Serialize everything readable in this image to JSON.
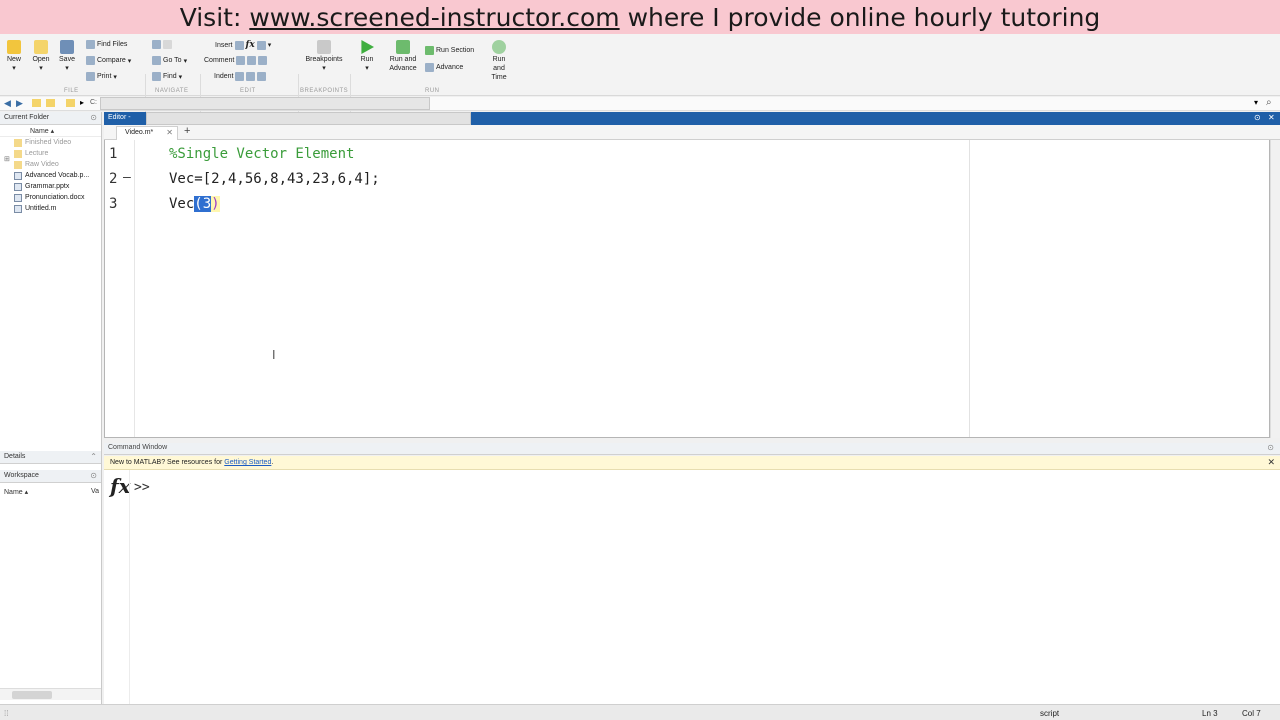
{
  "banner": {
    "prefix": "Visit:",
    "link": "www.screened-instructor.com",
    "suffix": "where I provide online hourly tutoring"
  },
  "toolbar": {
    "new": "New",
    "open": "Open",
    "save": "Save",
    "find_files": "Find Files",
    "compare": "Compare",
    "print": "Print",
    "go_to": "Go To",
    "find": "Find",
    "insert": "Insert",
    "comment": "Comment",
    "indent": "Indent",
    "breakpoints": "Breakpoints",
    "run": "Run",
    "run_and_advance": "Run and Advance",
    "run_section": "Run Section",
    "advance": "Advance",
    "run_and_time": "Run and Time",
    "groups": [
      "FILE",
      "NAVIGATE",
      "EDIT",
      "BREAKPOINTS",
      "RUN"
    ]
  },
  "address": {
    "crumb": "C:"
  },
  "current_folder": {
    "title": "Current Folder",
    "column": "Name",
    "items": [
      {
        "name": "Finished Video",
        "type": "folder"
      },
      {
        "name": "Lecture",
        "type": "folder"
      },
      {
        "name": "Raw Video",
        "type": "folder"
      },
      {
        "name": "Advanced Vocab.p...",
        "type": "file"
      },
      {
        "name": "Grammar.pptx",
        "type": "file"
      },
      {
        "name": "Pronunciation.docx",
        "type": "file"
      },
      {
        "name": "Untitled.m",
        "type": "file"
      }
    ]
  },
  "details": {
    "title": "Details"
  },
  "workspace": {
    "title": "Workspace",
    "column": "Name",
    "value_col": "Va"
  },
  "editor": {
    "title": "Editor -",
    "tab": "Video.m*",
    "lines": [
      {
        "num": "1",
        "text": "%Single Vector Element"
      },
      {
        "num": "2",
        "text": "Vec=[2,4,56,8,43,23,6,4];"
      },
      {
        "num": "3",
        "pre": "Vec",
        "sel": "(3",
        "post": ")"
      }
    ]
  },
  "command_window": {
    "title": "Command Window",
    "notice": "New to MATLAB? See resources for",
    "notice_link": "Getting Started",
    "notice_end": ".",
    "prompt": ">>"
  },
  "statusbar": {
    "mode": "script",
    "ln": "Ln  3",
    "col": "Col  7"
  }
}
